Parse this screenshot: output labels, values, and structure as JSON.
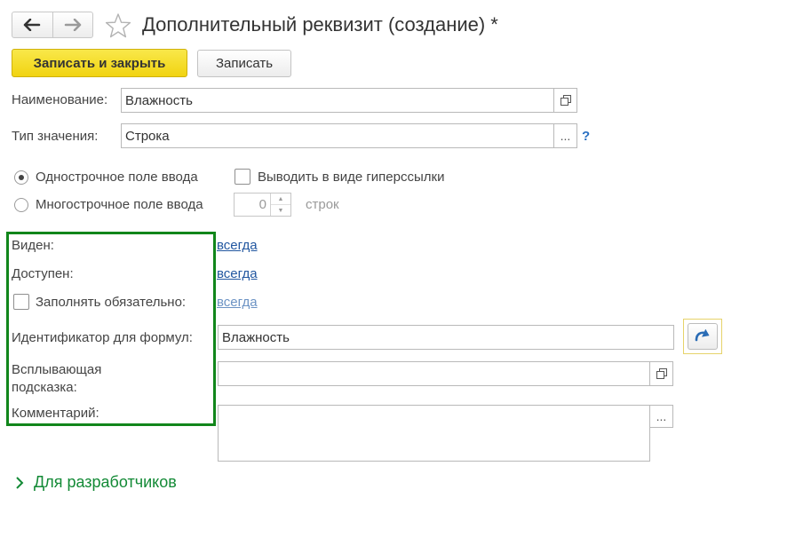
{
  "window": {
    "title": "Дополнительный реквизит (создание) *",
    "icons": {
      "back": "arrow-left-icon",
      "forward": "arrow-right-icon",
      "favorite": "star-icon"
    }
  },
  "toolbar": {
    "save_close_label": "Записать и закрыть",
    "save_label": "Записать"
  },
  "form": {
    "name_label": "Наименование:",
    "name_value": "Влажность",
    "type_label": "Тип значения:",
    "type_value": "Строка",
    "select_button": "...",
    "help": "?",
    "single_line_label": "Однострочное поле ввода",
    "single_line_selected": true,
    "multi_line_label": "Многострочное поле ввода",
    "hyperlink_label": "Выводить в виде гиперссылки",
    "hyperlink_checked": false,
    "lines_value": "0",
    "lines_unit": "строк",
    "visible_label": "Виден:",
    "visible_value": "всегда",
    "available_label": "Доступен:",
    "available_value": "всегда",
    "required_label": "Заполнять обязательно:",
    "required_value": "всегда",
    "required_checked": false,
    "identifier_label": "Идентификатор для формул:",
    "identifier_value": "Влажность",
    "tooltip_label_line1": "Всплывающая",
    "tooltip_label_line2": "подсказка:",
    "tooltip_value": "",
    "comment_label": "Комментарий:",
    "comment_button": "...",
    "comment_value": ""
  },
  "developers": {
    "label": "Для разработчиков"
  },
  "colors": {
    "primary_button": "#f5dc2a",
    "highlight_border": "#11861b",
    "link": "#2257a0",
    "section_header": "#138a36"
  }
}
